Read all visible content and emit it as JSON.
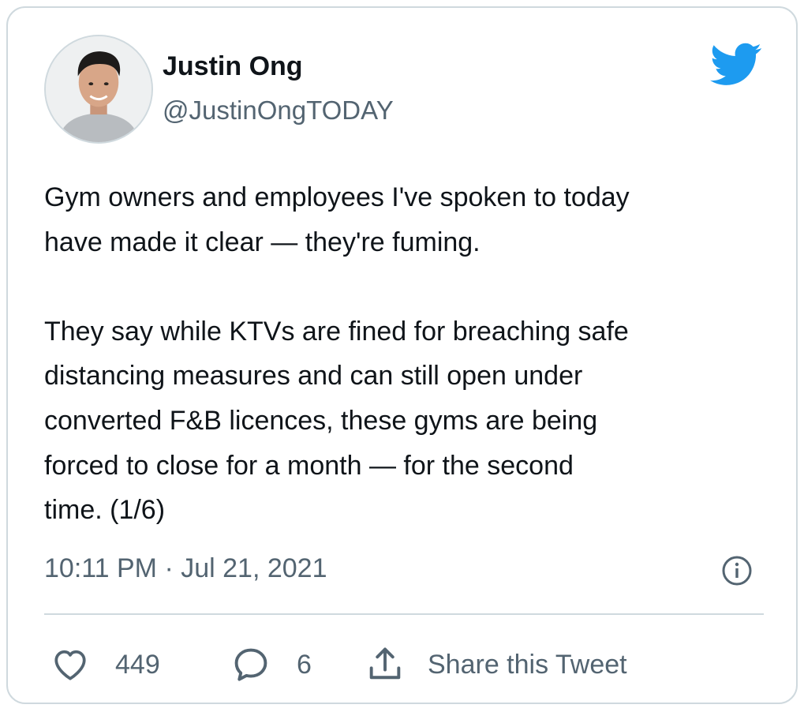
{
  "author": {
    "name": "Justin Ong",
    "handle": "@JustinOngTODAY"
  },
  "tweet": {
    "lines": [
      "Gym owners and employees I've spoken to today",
      "have made it clear — they're fuming.",
      "",
      "They say while KTVs are fined for breaching safe",
      "distancing measures and can still open under",
      "converted F&B licences, these gyms are being",
      "forced to close for a month — for the second",
      "time. (1/6)"
    ],
    "timestamp": "10:11 PM · Jul 21, 2021"
  },
  "actions": {
    "likes": "449",
    "replies": "6",
    "share_label": "Share this Tweet"
  },
  "icons": {
    "brand": "twitter-bird-icon",
    "info": "info-icon",
    "like": "heart-icon",
    "reply": "speech-bubble-icon",
    "share": "share-upload-icon"
  },
  "colors": {
    "brand": "#1d9bf0",
    "text": "#0f1419",
    "secondary": "#536471",
    "border": "#cfd9de"
  }
}
